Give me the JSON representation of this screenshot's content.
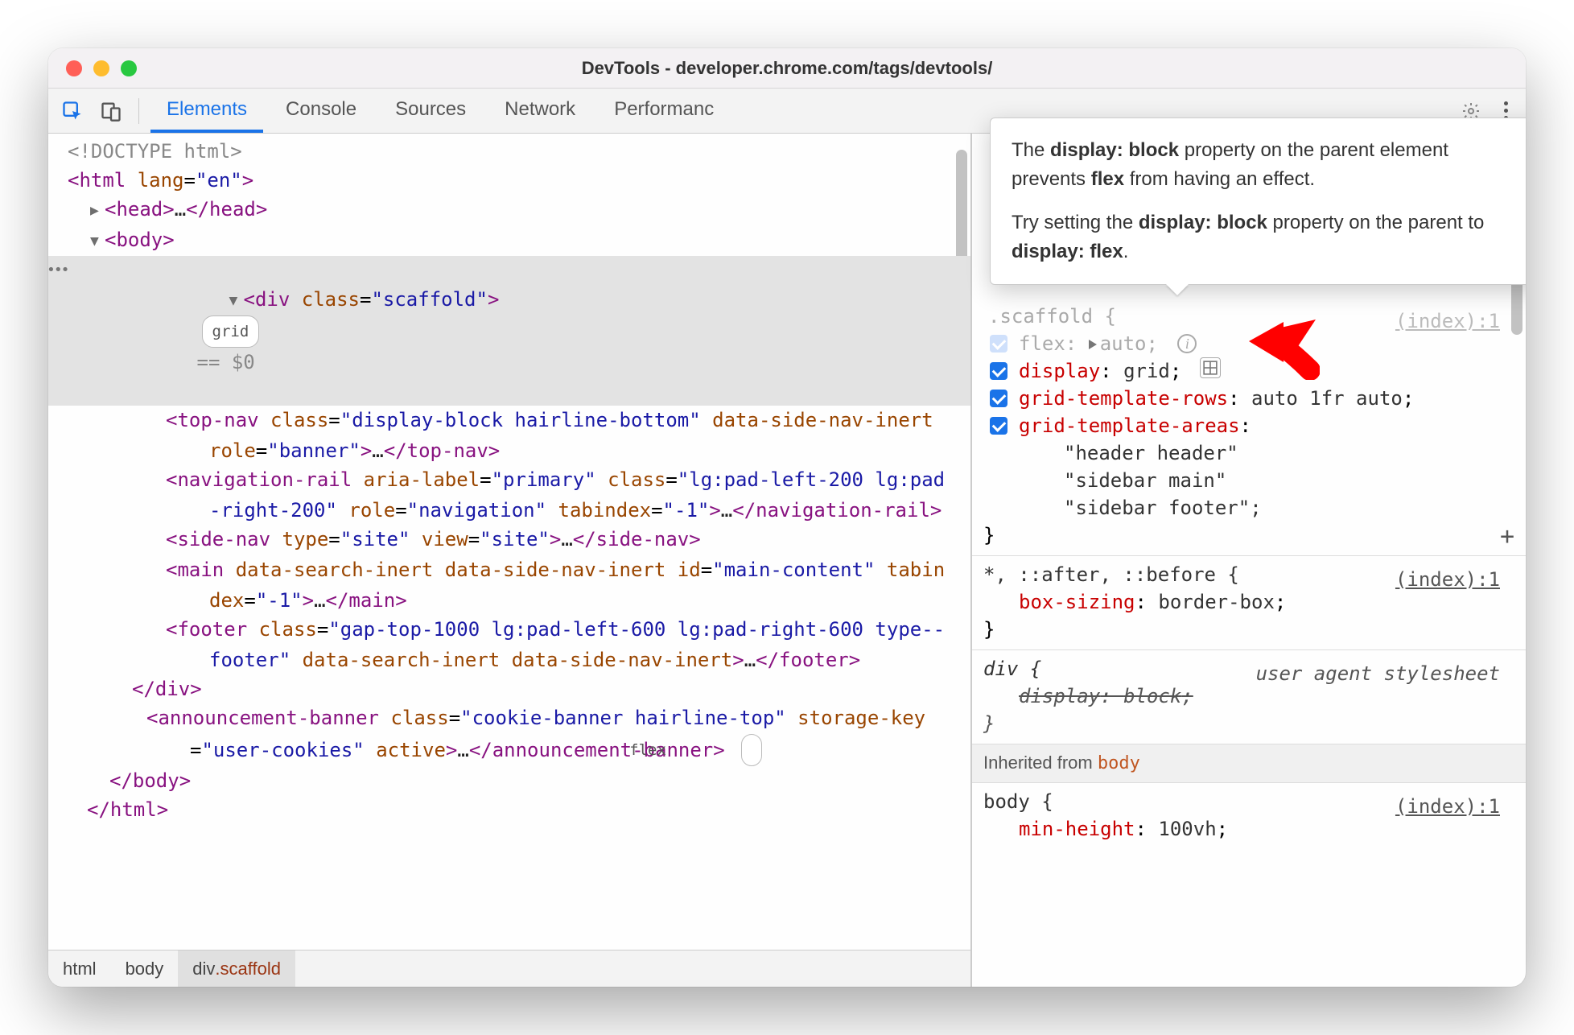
{
  "title": "DevTools - developer.chrome.com/tags/devtools/",
  "tabs": {
    "elements": "Elements",
    "console": "Console",
    "sources": "Sources",
    "network": "Network",
    "performance": "Performanc"
  },
  "dom": {
    "doctype": "<!DOCTYPE html>",
    "html_open": "<html lang=\"en\">",
    "head": "<head>…</head>",
    "body_open": "<body>",
    "scaffold_open": "<div class=\"scaffold\">",
    "scaffold_badge": "grid",
    "eq0": "== $0",
    "topnav": "<top-nav class=\"display-block hairline-bottom\" data-side-nav-inert role=\"banner\">…</top-nav>",
    "navrail": "<navigation-rail aria-label=\"primary\" class=\"lg:pad-left-200 lg:pad-right-200\" role=\"navigation\" tabindex=\"-1\">…</navigation-rail>",
    "sidenav": "<side-nav type=\"site\" view=\"site\">…</side-nav>",
    "main": "<main data-search-inert data-side-nav-inert id=\"main-content\" tabindex=\"-1\">…</main>",
    "footer": "<footer class=\"gap-top-1000 lg:pad-left-600 lg:pad-right-600 type--footer\" data-search-inert data-side-nav-inert>…</footer>",
    "div_close": "</div>",
    "banner": "<announcement-banner class=\"cookie-banner hairline-top\" storage-key=\"user-cookies\" active>…</announcement-banner>",
    "banner_badge": "flex",
    "body_close": "</body>",
    "html_close": "</html>"
  },
  "breadcrumb": {
    "c0": "html",
    "c1": "body",
    "c2_el": "div",
    "c2_cls": ".scaffold"
  },
  "tooltip": {
    "p1_a": "The ",
    "p1_b": "display: block",
    "p1_c": " property on the parent element prevents ",
    "p1_d": "flex",
    "p1_e": " from having an effect.",
    "p2_a": "Try setting the ",
    "p2_b": "display: block",
    "p2_c": " property on the parent to ",
    "p2_d": "display: flex",
    "p2_e": "."
  },
  "styles": {
    "scaffold_sel": ".scaffold {",
    "scaffold_src": "(index):1",
    "flex_prop": "flex",
    "flex_val": "auto",
    "display_prop": "display",
    "display_val": "grid",
    "gtr_prop": "grid-template-rows",
    "gtr_val": "auto 1fr auto",
    "gta_prop": "grid-template-areas",
    "gta_l1": "\"header header\"",
    "gta_l2": "\"sidebar main\"",
    "gta_l3": "\"sidebar footer\"",
    "close": "}",
    "univ_sel": "*, ::after, ::before {",
    "univ_src": "(index):1",
    "bs_prop": "box-sizing",
    "bs_val": "border-box",
    "div_sel": "div {",
    "ua_label": "user agent stylesheet",
    "div_disp_prop": "display",
    "div_disp_val": "block",
    "inherit_label": "Inherited from ",
    "inherit_el": "body",
    "body_sel": "body {",
    "body_src": "(index):1",
    "mh_prop": "min-height",
    "mh_val": "100vh"
  }
}
